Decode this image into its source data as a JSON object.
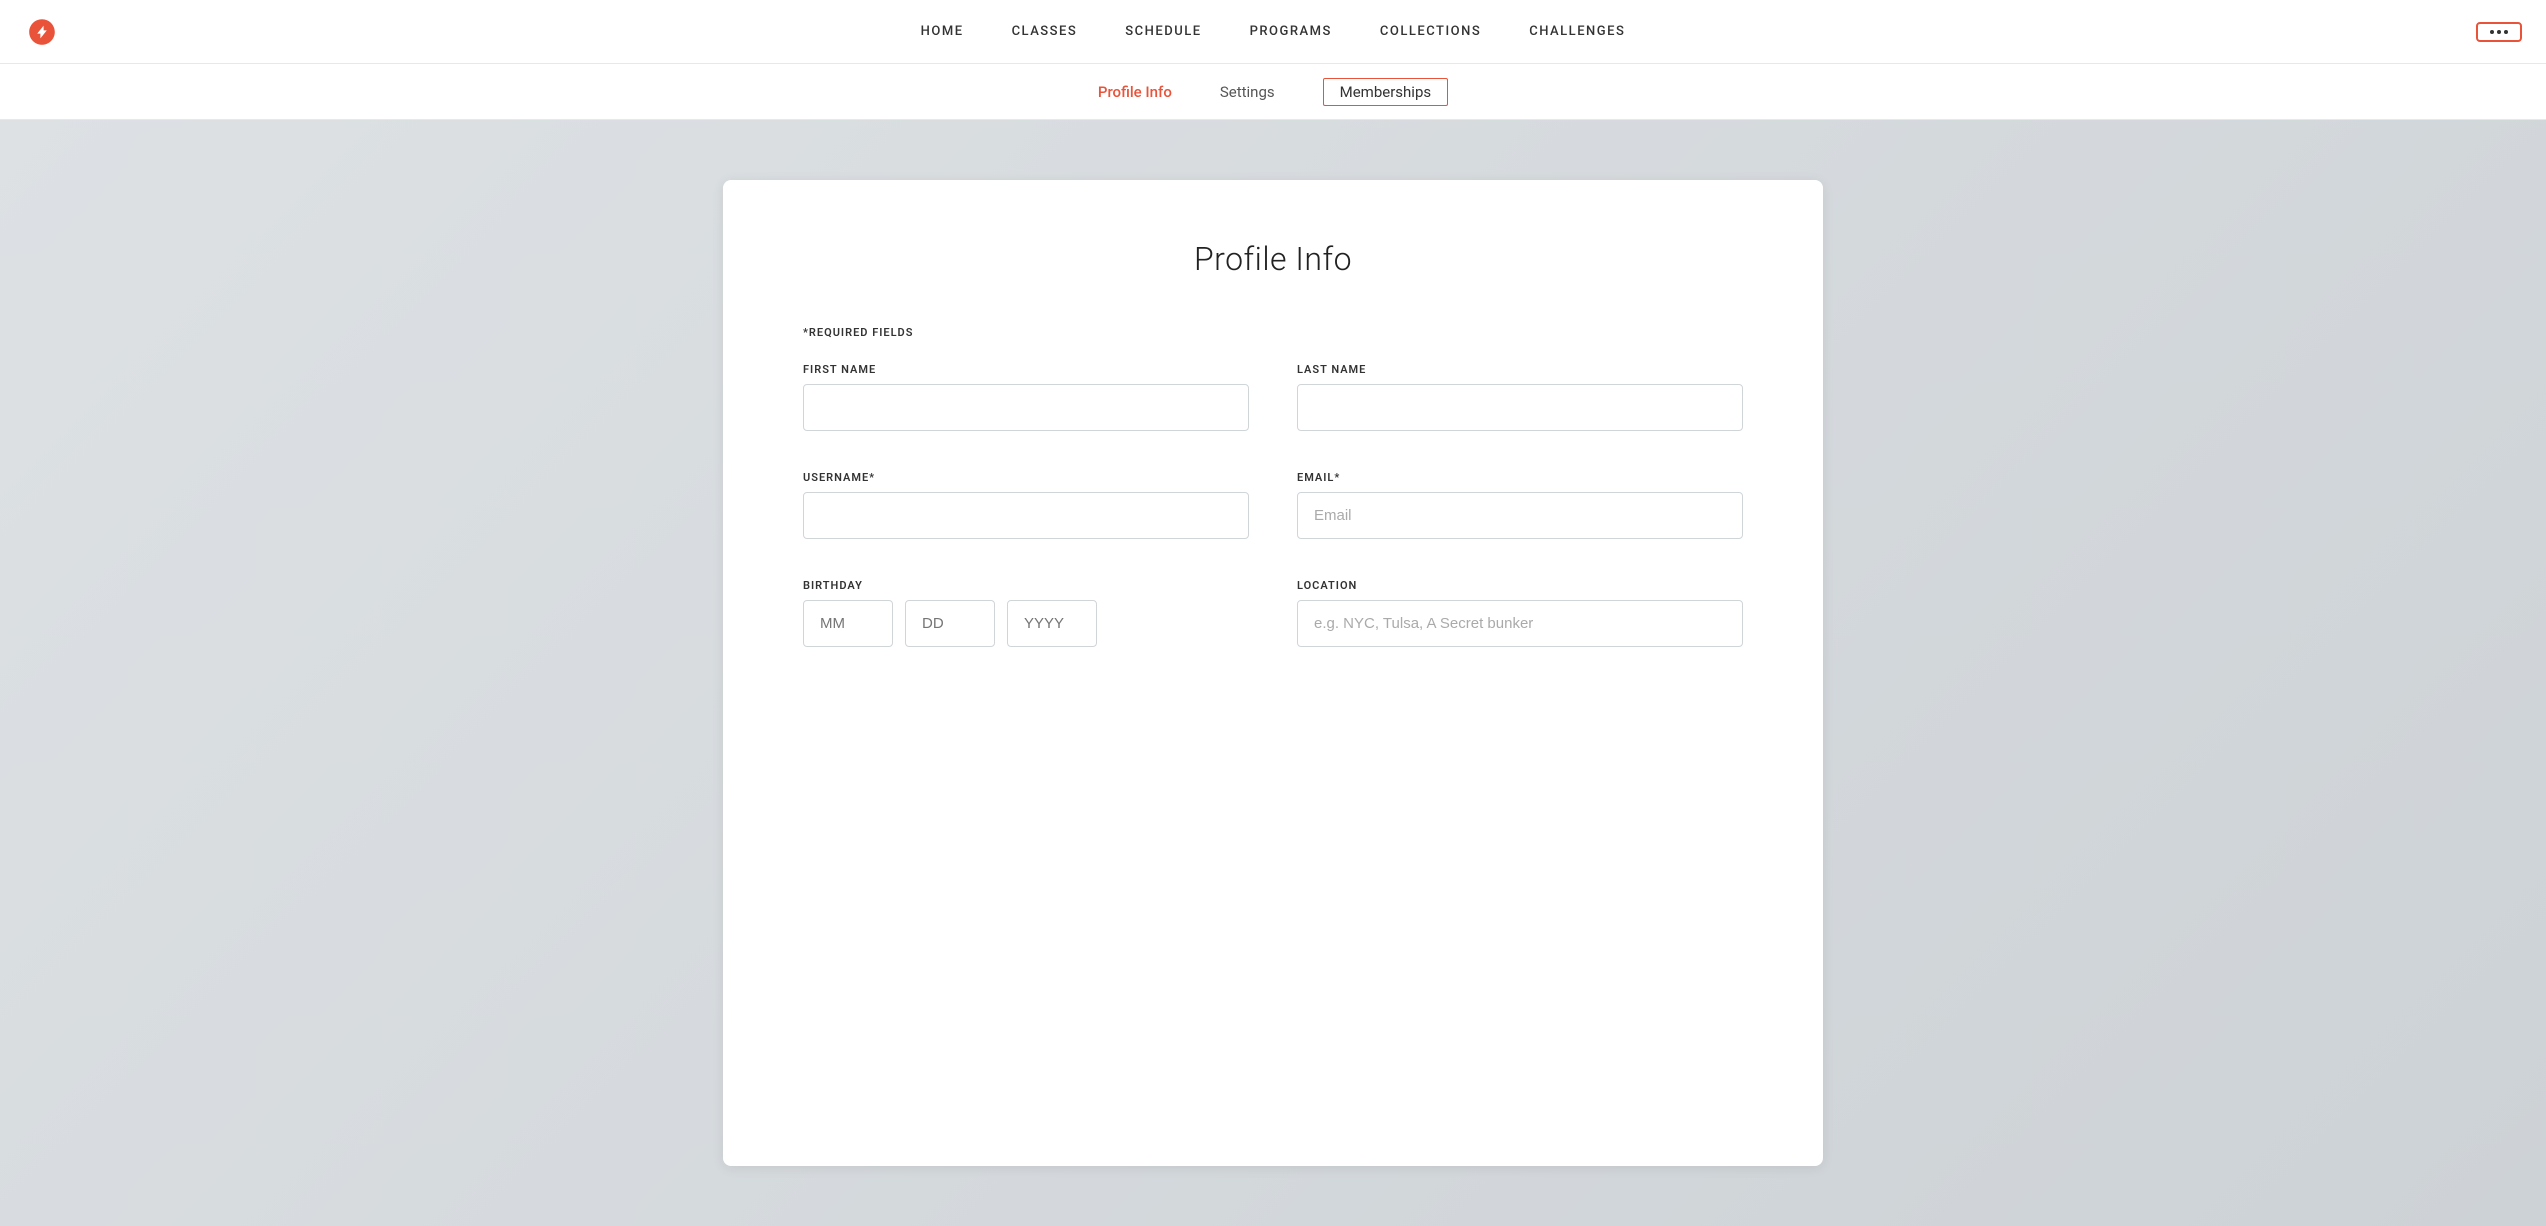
{
  "nav": {
    "links": [
      {
        "label": "HOME",
        "id": "home"
      },
      {
        "label": "CLASSES",
        "id": "classes"
      },
      {
        "label": "SCHEDULE",
        "id": "schedule"
      },
      {
        "label": "PROGRAMS",
        "id": "programs"
      },
      {
        "label": "COLLECTIONS",
        "id": "collections"
      },
      {
        "label": "CHALLENGES",
        "id": "challenges"
      }
    ],
    "more_button_label": "···"
  },
  "profile_tabs": {
    "tab_profile": "Profile Info",
    "tab_settings": "Settings",
    "tab_memberships": "Memberships"
  },
  "form": {
    "title": "Profile Info",
    "required_note": "*REQUIRED FIELDS",
    "first_name_label": "FIRST NAME",
    "last_name_label": "LAST NAME",
    "username_label": "USERNAME*",
    "email_label": "EMAIL*",
    "email_placeholder": "Email",
    "birthday_label": "BIRTHDAY",
    "location_label": "LOCATION",
    "birthday_mm": "MM",
    "birthday_dd": "DD",
    "birthday_yyyy": "YYYY",
    "location_placeholder": "e.g. NYC, Tulsa, A Secret bunker"
  }
}
